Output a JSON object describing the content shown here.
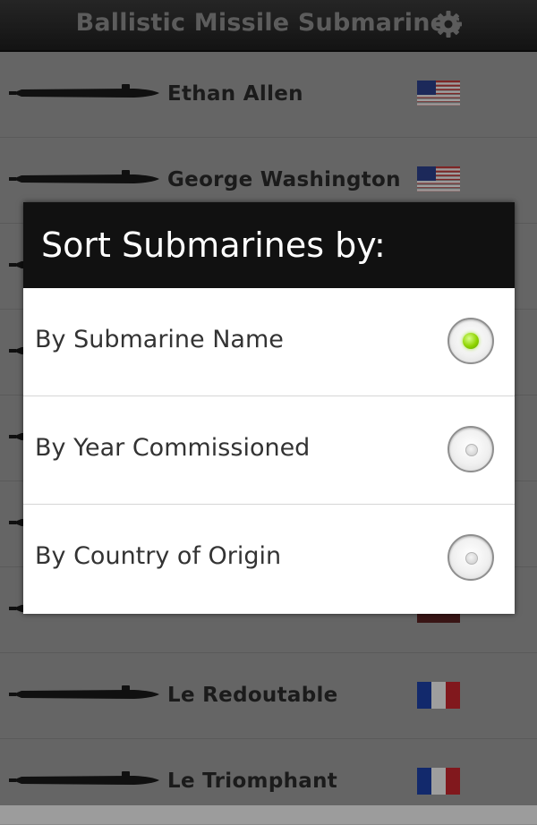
{
  "app": {
    "title": "Ballistic Missile Submarines",
    "settings_icon": "gear-icon"
  },
  "list": {
    "rows": [
      {
        "name": "Ethan Allen",
        "flag": "usa-flag-icon"
      },
      {
        "name": "George Washington",
        "flag": "usa-flag-icon"
      },
      {
        "name": "",
        "flag": "hidden-flag-icon"
      },
      {
        "name": "",
        "flag": ""
      },
      {
        "name": "",
        "flag": ""
      },
      {
        "name": "",
        "flag": ""
      },
      {
        "name": "",
        "flag": "hidden-flag-icon"
      },
      {
        "name": "Le Redoutable",
        "flag": "france-flag-icon"
      },
      {
        "name": "Le Triomphant",
        "flag": "france-flag-icon"
      }
    ]
  },
  "dialog": {
    "title": "Sort Submarines by:",
    "options": [
      {
        "label": "By Submarine Name",
        "selected": true
      },
      {
        "label": "By Year Commissioned",
        "selected": false
      },
      {
        "label": "By Country of Origin",
        "selected": false
      }
    ]
  },
  "colors": {
    "title_text": "#8e8e8e",
    "radio_selected": "#8fd400",
    "dialog_header": "#111111"
  }
}
